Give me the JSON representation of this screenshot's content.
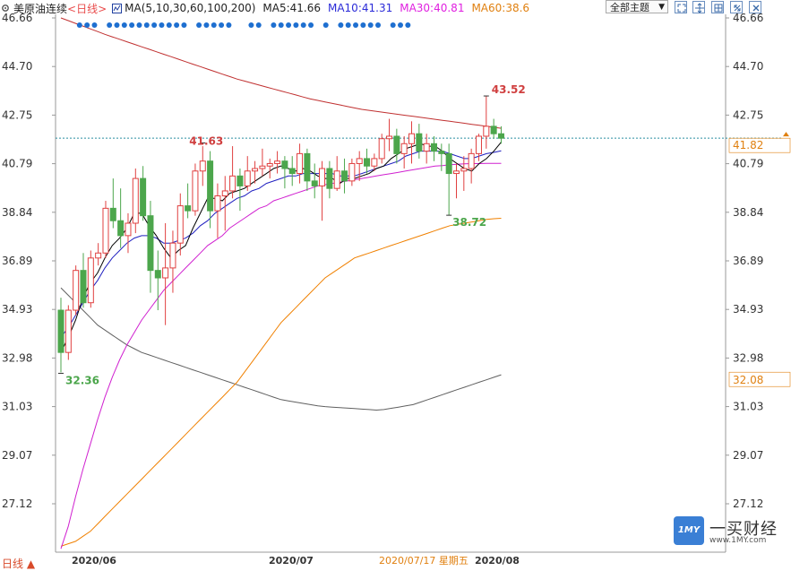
{
  "header": {
    "instrument": "美原油连续",
    "period": "<日线>",
    "ma_params": "MA(5,10,30,60,100,200)",
    "ma5": "MA5:41.66",
    "ma10": "MA10:41.31",
    "ma30": "MA30:40.81",
    "ma60": "MA60:38.6"
  },
  "toolbar": {
    "theme_select": "全部主题",
    "buttons": [
      "expand-icon",
      "fullscreen-icon",
      "settings-icon",
      "restore-icon",
      "close-icon"
    ]
  },
  "footer": {
    "period_label": "日线 ▲"
  },
  "watermark": {
    "logo": "1MY",
    "name": "一买财经",
    "url": "www.1MY.com"
  },
  "colors": {
    "up": "#e04040",
    "down": "#4ca64c",
    "ma5": "#000000",
    "ma10": "#2020c0",
    "ma30": "#d020d0",
    "ma60": "#f08000",
    "ma100": "#606060",
    "ma200": "#c03030",
    "current_price": "#2a8fa0",
    "dots": "#1e6fd0"
  },
  "chart_data": {
    "type": "candlestick",
    "y_ticks": [
      "46.66",
      "44.70",
      "42.75",
      "40.79",
      "38.84",
      "36.89",
      "34.93",
      "32.98",
      "31.03",
      "29.07",
      "27.12"
    ],
    "ylim": [
      25.17,
      46.66
    ],
    "x_labels": [
      "2020/06",
      "2020/07",
      "2020/07/17 星期五",
      "2020/08"
    ],
    "annotations": {
      "high": "43.52",
      "low_mid": "38.72",
      "prev_high": "41.63",
      "low_start": "32.36"
    },
    "current_price": "41.82",
    "ma60_axis_label": "32.08",
    "candles": [
      [
        34.9,
        35.4,
        32.4,
        33.2
      ],
      [
        33.2,
        35.1,
        32.9,
        34.9
      ],
      [
        34.9,
        36.7,
        34.7,
        36.5
      ],
      [
        36.5,
        37.2,
        35.0,
        35.2
      ],
      [
        35.2,
        37.3,
        35.0,
        37.0
      ],
      [
        37.0,
        37.6,
        36.7,
        37.2
      ],
      [
        37.2,
        39.3,
        37.0,
        39.0
      ],
      [
        39.0,
        40.2,
        38.2,
        38.5
      ],
      [
        38.5,
        39.8,
        37.4,
        37.9
      ],
      [
        37.9,
        38.8,
        37.2,
        38.4
      ],
      [
        38.4,
        40.6,
        38.0,
        40.2
      ],
      [
        40.2,
        40.7,
        38.5,
        38.7
      ],
      [
        38.7,
        39.3,
        35.6,
        36.5
      ],
      [
        36.5,
        37.3,
        34.9,
        36.2
      ],
      [
        36.2,
        38.4,
        34.3,
        36.6
      ],
      [
        36.6,
        38.1,
        35.6,
        37.6
      ],
      [
        37.6,
        39.6,
        37.1,
        39.1
      ],
      [
        39.1,
        40.0,
        38.6,
        38.9
      ],
      [
        38.9,
        40.8,
        38.7,
        40.5
      ],
      [
        40.5,
        41.5,
        39.9,
        40.9
      ]
    ],
    "candles_b": [
      [
        40.9,
        41.3,
        38.2,
        38.9
      ],
      [
        38.9,
        40.0,
        37.8,
        39.5
      ],
      [
        39.5,
        40.3,
        38.1,
        39.7
      ],
      [
        39.7,
        41.5,
        39.4,
        40.3
      ],
      [
        40.3,
        40.6,
        38.9,
        39.9
      ],
      [
        39.9,
        41.1,
        39.7,
        40.5
      ],
      [
        40.5,
        40.9,
        40.0,
        40.6
      ],
      [
        40.6,
        41.4,
        40.3,
        40.7
      ]
    ],
    "candles_c": [
      [
        40.7,
        41.0,
        40.2,
        40.8
      ],
      [
        40.8,
        41.3,
        40.4,
        40.9
      ],
      [
        40.9,
        41.1,
        39.8,
        40.6
      ],
      [
        40.6,
        41.1,
        39.9,
        40.4
      ],
      [
        40.4,
        41.6,
        40.0,
        41.2
      ],
      [
        41.2,
        41.4,
        39.7,
        40.1
      ],
      [
        40.1,
        40.8,
        39.4,
        39.9
      ],
      [
        39.9,
        40.9,
        38.5,
        40.6
      ],
      [
        40.6,
        40.9,
        39.4,
        39.8
      ],
      [
        39.8,
        41.1,
        39.7,
        40.5
      ],
      [
        40.5,
        41.0,
        39.6,
        40.1
      ],
      [
        40.1,
        41.0,
        39.9,
        40.8
      ],
      [
        40.8,
        41.3,
        40.1,
        41.0
      ],
      [
        41.0,
        41.4,
        40.4,
        40.7
      ],
      [
        40.7,
        41.2,
        40.5,
        41.0
      ],
      [
        41.0,
        42.0,
        40.8,
        41.8
      ]
    ],
    "candles_d": [
      [
        41.8,
        42.6,
        41.3,
        41.9
      ],
      [
        41.9,
        42.2,
        40.8,
        41.2
      ],
      [
        41.2,
        41.9,
        40.6,
        41.6
      ],
      [
        41.6,
        42.5,
        40.8,
        42.0
      ],
      [
        42.0,
        42.4,
        41.0,
        41.3
      ],
      [
        41.3,
        42.0,
        40.8,
        41.6
      ],
      [
        41.6,
        41.9,
        40.9,
        41.3
      ],
      [
        41.3,
        41.6,
        40.5,
        41.2
      ],
      [
        41.2,
        41.6,
        38.72,
        40.4
      ],
      [
        40.4,
        40.8,
        39.4,
        40.5
      ],
      [
        40.5,
        41.1,
        39.7,
        40.6
      ],
      [
        40.6,
        41.4,
        40.0,
        41.2
      ],
      [
        41.2,
        42.0,
        40.9,
        41.9
      ],
      [
        41.9,
        43.52,
        41.4,
        42.3
      ],
      [
        42.3,
        42.6,
        41.8,
        42.0
      ],
      [
        42.0,
        42.3,
        41.6,
        41.82
      ]
    ],
    "ma5": [
      33.2,
      33.8,
      34.5,
      35.4,
      36.0,
      36.4,
      37.0,
      37.5,
      37.8,
      38.2,
      38.8,
      38.8,
      38.3,
      37.9,
      37.4,
      37.0,
      37.3,
      37.5,
      38.2,
      38.8,
      39.4,
      39.4,
      39.3,
      39.6,
      39.7,
      39.8,
      40.0,
      40.2,
      40.4,
      40.6,
      40.7,
      40.6,
      40.5,
      40.6,
      40.5,
      40.3,
      40.2,
      40.2,
      40.0,
      40.2,
      40.2,
      40.3,
      40.4,
      40.6,
      40.7,
      41.0,
      41.2,
      41.4,
      41.5,
      41.6,
      41.5,
      41.5,
      41.3,
      41.0,
      40.8,
      40.6,
      40.5,
      40.8,
      41.0,
      41.3,
      41.66
    ],
    "ma10": [
      33.8,
      34.2,
      34.7,
      35.2,
      35.7,
      36.1,
      36.6,
      37.0,
      37.3,
      37.6,
      37.8,
      37.9,
      37.9,
      37.8,
      37.6,
      37.6,
      37.7,
      37.8,
      38.0,
      38.3,
      38.5,
      38.8,
      39.0,
      39.2,
      39.4,
      39.5,
      39.7,
      39.8,
      40.0,
      40.1,
      40.2,
      40.3,
      40.3,
      40.4,
      40.4,
      40.4,
      40.4,
      40.4,
      40.3,
      40.3,
      40.3,
      40.4,
      40.5,
      40.6,
      40.7,
      40.8,
      40.9,
      41.1,
      41.2,
      41.3,
      41.3,
      41.3,
      41.3,
      41.2,
      41.1,
      41.0,
      41.0,
      41.1,
      41.2,
      41.25,
      41.31
    ],
    "ma30": [
      25.3,
      26.2,
      27.4,
      28.5,
      29.5,
      30.5,
      31.4,
      32.2,
      32.9,
      33.5,
      34.0,
      34.5,
      34.9,
      35.3,
      35.7,
      36.0,
      36.3,
      36.6,
      36.9,
      37.2,
      37.5,
      37.7,
      37.9,
      38.2,
      38.4,
      38.6,
      38.8,
      39.0,
      39.1,
      39.3,
      39.4,
      39.5,
      39.6,
      39.7,
      39.8,
      39.9,
      39.95,
      40.0,
      40.05,
      40.1,
      40.15,
      40.2,
      40.25,
      40.3,
      40.35,
      40.4,
      40.45,
      40.5,
      40.55,
      40.6,
      40.65,
      40.7,
      40.72,
      40.75,
      40.77,
      40.79,
      40.8,
      40.8,
      40.81,
      40.81,
      40.81
    ],
    "ma60": [
      25.4,
      25.5,
      25.6,
      25.8,
      26.0,
      26.3,
      26.6,
      26.9,
      27.2,
      27.5,
      27.8,
      28.1,
      28.4,
      28.7,
      29.0,
      29.3,
      29.6,
      29.9,
      30.2,
      30.5,
      30.8,
      31.1,
      31.4,
      31.7,
      32.0,
      32.4,
      32.8,
      33.2,
      33.6,
      34.0,
      34.4,
      34.7,
      35.0,
      35.3,
      35.6,
      35.9,
      36.2,
      36.4,
      36.6,
      36.8,
      37.0,
      37.1,
      37.2,
      37.3,
      37.4,
      37.5,
      37.6,
      37.7,
      37.8,
      37.9,
      38.0,
      38.1,
      38.2,
      38.3,
      38.35,
      38.4,
      38.45,
      38.5,
      38.55,
      38.58,
      38.6
    ],
    "ma100": [
      35.8,
      35.5,
      35.2,
      34.9,
      34.6,
      34.3,
      34.1,
      33.9,
      33.7,
      33.5,
      33.35,
      33.2,
      33.1,
      33.0,
      32.9,
      32.8,
      32.7,
      32.6,
      32.5,
      32.4,
      32.3,
      32.2,
      32.1,
      32.0,
      31.9,
      31.8,
      31.7,
      31.6,
      31.5,
      31.4,
      31.3,
      31.25,
      31.2,
      31.15,
      31.1,
      31.05,
      31.02,
      31.0,
      30.98,
      30.96,
      30.94,
      30.92,
      30.9,
      30.88,
      30.9,
      30.95,
      31.0,
      31.05,
      31.1,
      31.2,
      31.3,
      31.4,
      31.5,
      31.6,
      31.7,
      31.8,
      31.9,
      32.0,
      32.1,
      32.2,
      32.3
    ],
    "ma200": [
      46.66,
      46.55,
      46.44,
      46.33,
      46.22,
      46.11,
      46.0,
      45.9,
      45.8,
      45.7,
      45.6,
      45.5,
      45.4,
      45.3,
      45.2,
      45.1,
      45.0,
      44.9,
      44.8,
      44.7,
      44.6,
      44.5,
      44.4,
      44.3,
      44.2,
      44.12,
      44.04,
      43.96,
      43.88,
      43.8,
      43.72,
      43.64,
      43.56,
      43.48,
      43.4,
      43.34,
      43.28,
      43.22,
      43.16,
      43.1,
      43.04,
      42.98,
      42.94,
      42.9,
      42.86,
      42.82,
      42.78,
      42.74,
      42.7,
      42.66,
      42.62,
      42.58,
      42.54,
      42.5,
      42.46,
      42.42,
      42.38,
      42.34,
      42.3,
      42.26,
      42.22
    ],
    "dot_groups": [
      3,
      11,
      5,
      2,
      6,
      1,
      6,
      3
    ]
  }
}
